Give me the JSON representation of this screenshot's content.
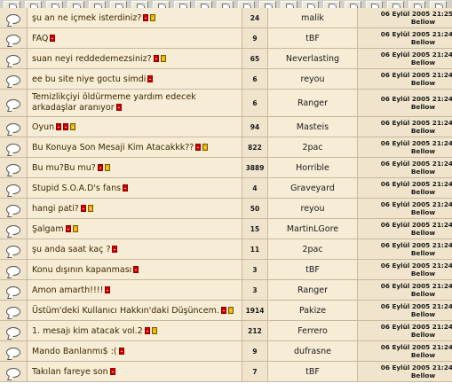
{
  "toolbar_button_count": 21,
  "rows": [
    {
      "title": "şu an ne içmek isterdiniz?",
      "pages": [
        "r",
        "y"
      ],
      "replies": "24",
      "author": "malik",
      "last_date": "06 Eylül 2005 21:25",
      "last_user": "Bellow"
    },
    {
      "title": "FAQ",
      "pages": [
        "r"
      ],
      "replies": "9",
      "author": "tBF",
      "last_date": "06 Eylül 2005 21:24",
      "last_user": "Bellow"
    },
    {
      "title": "suan neyi reddedemezsiniz?",
      "pages": [
        "r",
        "y"
      ],
      "replies": "65",
      "author": "Neverlasting",
      "last_date": "06 Eylül 2005 21:24",
      "last_user": "Bellow"
    },
    {
      "title": "ee bu site niye goctu simdi",
      "pages": [
        "r"
      ],
      "replies": "6",
      "author": "reyou",
      "last_date": "06 Eylül 2005 21:24",
      "last_user": "Bellow"
    },
    {
      "title": "Temizlikçiyi öldürmeme yardım edecek arkadaşlar aranıyor",
      "pages": [
        "r"
      ],
      "replies": "6",
      "author": "Ranger",
      "last_date": "06 Eylül 2005 21:24",
      "last_user": "Bellow",
      "tall": true
    },
    {
      "title": "Oyun",
      "pages": [
        "r",
        "r",
        "y"
      ],
      "replies": "94",
      "author": "Masteis",
      "last_date": "06 Eylül 2005 21:24",
      "last_user": "Bellow"
    },
    {
      "title": "Bu Konuya Son Mesaji Kim Atacakkk??",
      "pages": [
        "r",
        "y"
      ],
      "replies": "822",
      "author": "2pac",
      "last_date": "06 Eylül 2005 21:24",
      "last_user": "Bellow"
    },
    {
      "title": "Bu mu?Bu mu?",
      "pages": [
        "r",
        "y"
      ],
      "replies": "3889",
      "author": "Horrible",
      "last_date": "06 Eylül 2005 21:24",
      "last_user": "Bellow"
    },
    {
      "title": "Stupid S.O.A.D's fans",
      "pages": [
        "r"
      ],
      "replies": "4",
      "author": "Graveyard",
      "last_date": "06 Eylül 2005 21:24",
      "last_user": "Bellow"
    },
    {
      "title": "hangi pati?",
      "pages": [
        "r",
        "y"
      ],
      "replies": "50",
      "author": "reyou",
      "last_date": "06 Eylül 2005 21:24",
      "last_user": "Bellow"
    },
    {
      "title": "Şalgam",
      "pages": [
        "r",
        "y"
      ],
      "replies": "15",
      "author": "MartinLGore",
      "last_date": "06 Eylül 2005 21:24",
      "last_user": "Bellow"
    },
    {
      "title": "şu anda saat kaç ?",
      "pages": [
        "r"
      ],
      "replies": "11",
      "author": "2pac",
      "last_date": "06 Eylül 2005 21:24",
      "last_user": "Bellow"
    },
    {
      "title": "Konu dışının kapanması",
      "pages": [
        "r"
      ],
      "replies": "3",
      "author": "tBF",
      "last_date": "06 Eylül 2005 21:24",
      "last_user": "Bellow"
    },
    {
      "title": "Amon amarth!!!!",
      "pages": [
        "r"
      ],
      "replies": "3",
      "author": "Ranger",
      "last_date": "06 Eylül 2005 21:24",
      "last_user": "Bellow"
    },
    {
      "title": "Üstüm'deki Kullanıcı Hakkın'daki Düşüncem.",
      "pages": [
        "r",
        "y"
      ],
      "replies": "1914",
      "author": "Pakize",
      "last_date": "06 Eylül 2005 21:24",
      "last_user": "Bellow"
    },
    {
      "title": "1. mesajı kim atacak vol.2",
      "pages": [
        "r",
        "y"
      ],
      "replies": "212",
      "author": "Ferrero",
      "last_date": "06 Eylül 2005 21:24",
      "last_user": "Bellow"
    },
    {
      "title": "Mando Banlanmı$ :(",
      "pages": [
        "r"
      ],
      "replies": "9",
      "author": "dufrasne",
      "last_date": "06 Eylül 2005 21:24",
      "last_user": "Bellow"
    },
    {
      "title": "Takılan fareye son",
      "pages": [
        "r"
      ],
      "replies": "7",
      "author": "tBF",
      "last_date": "06 Eylül 2005 21:24",
      "last_user": "Bellow"
    }
  ]
}
